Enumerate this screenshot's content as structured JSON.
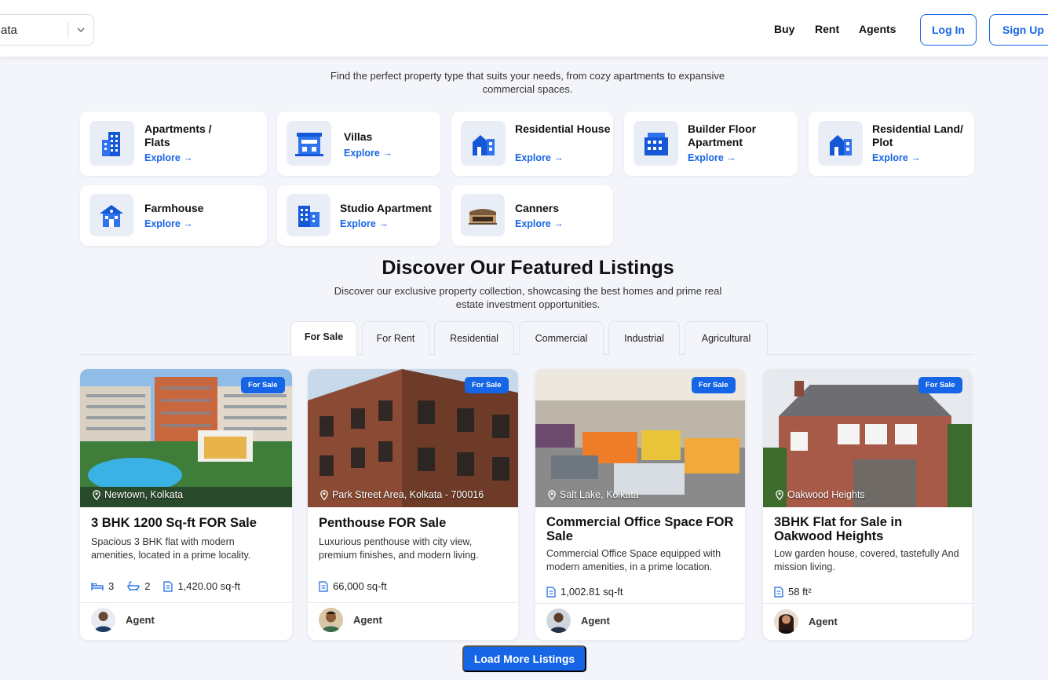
{
  "header": {
    "city": "ata",
    "nav": [
      "Buy",
      "Rent",
      "Agents"
    ],
    "login": "Log In",
    "signup": "Sign Up"
  },
  "intro": "Find the perfect property type that suits your needs, from cozy apartments to expansive commercial spaces.",
  "property_types": [
    {
      "title": "Apartments / Flats",
      "explore": "Explore →",
      "icon": "apartment-building-icon"
    },
    {
      "title": "Villas",
      "explore": "Explore →",
      "icon": "villa-icon"
    },
    {
      "title": "Residential House",
      "explore": "Explore →",
      "icon": "house-icon"
    },
    {
      "title": "Builder Floor Apartment",
      "explore": "Explore →",
      "icon": "builder-floor-icon"
    },
    {
      "title": "Residential Land/ Plot",
      "explore": "Explore →",
      "icon": "land-plot-icon"
    },
    {
      "title": "Farmhouse",
      "explore": "Explore →",
      "icon": "farmhouse-icon"
    },
    {
      "title": "Studio Apartment",
      "explore": "Explore →",
      "icon": "studio-icon"
    },
    {
      "title": "Canners",
      "explore": "Explore →",
      "icon": "canners-photo-icon"
    }
  ],
  "featured": {
    "title": "Discover Our Featured Listings",
    "subtitle": "Discover our exclusive property collection, showcasing the best homes and prime real estate investment opportunities."
  },
  "tabs": [
    "For Sale",
    "For Rent",
    "Residential",
    "Commercial",
    "Industrial",
    "Agricultural"
  ],
  "active_tab": "For Sale",
  "listings": [
    {
      "badge": "For Sale",
      "location": "Newtown, Kolkata",
      "title": "3 BHK 1200 Sq-ft FOR Sale",
      "description": "Spacious 3 BHK flat with modern amenities, located in a prime locality.",
      "beds": "3",
      "baths": "2",
      "area": "1,420.00 sq-ft",
      "agent": "Agent"
    },
    {
      "badge": "For Sale",
      "location": "Park Street Area, Kolkata - 700016",
      "title": "Penthouse FOR Sale",
      "description": "Luxurious penthouse with city view, premium finishes, and modern living.",
      "area": "66,000 sq-ft",
      "agent": "Agent"
    },
    {
      "badge": "For Sale",
      "location": "Salt Lake, Kolkata",
      "title": "Commercial Office Space FOR Sale",
      "description": "Commercial Office Space equipped with modern amenities, in a prime location.",
      "area": "1,002.81 sq-ft",
      "agent": "Agent"
    },
    {
      "badge": "For Sale",
      "location": "Oakwood Heights",
      "title": "3BHK Flat for Sale in Oakwood Heights",
      "description": "Low garden house, covered, tastefully And mission living.",
      "area": "58 ft²",
      "agent": "Agent"
    }
  ],
  "load_more": "Load More Listings",
  "colors": {
    "accent": "#1565e6",
    "background": "#f3f5fb",
    "card": "#ffffff"
  }
}
